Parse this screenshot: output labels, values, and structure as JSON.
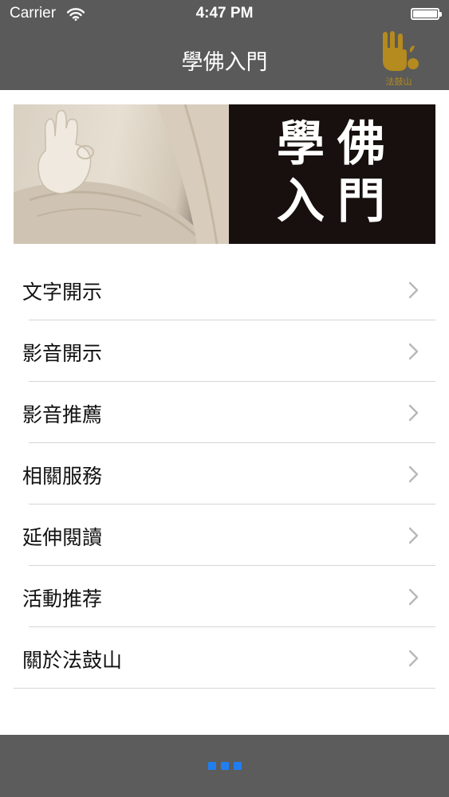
{
  "status_bar": {
    "carrier": "Carrier",
    "time": "4:47 PM",
    "wifi_icon": "wifi-icon",
    "battery_icon": "battery-icon"
  },
  "nav": {
    "title": "學佛入門",
    "logo": {
      "icon": "dharma-drum-logo",
      "text": "法鼓山",
      "color": "#b58a1e"
    }
  },
  "banner": {
    "text": "學佛入門",
    "image": "buddha-hand-image"
  },
  "menu": {
    "items": [
      {
        "label": "文字開示"
      },
      {
        "label": "影音開示"
      },
      {
        "label": "影音推薦"
      },
      {
        "label": "相關服務"
      },
      {
        "label": "延伸閱讀"
      },
      {
        "label": "活動推荐"
      },
      {
        "label": "關於法鼓山"
      }
    ],
    "chevron_icon": "chevron-right-icon"
  },
  "bottom_bar": {
    "page_dots": 3,
    "dot_color": "#1f7ff0"
  },
  "colors": {
    "bar": "#5a5a5a",
    "background": "#ffffff",
    "separator": "#d6d6d6",
    "chevron": "#b8b8b8"
  }
}
